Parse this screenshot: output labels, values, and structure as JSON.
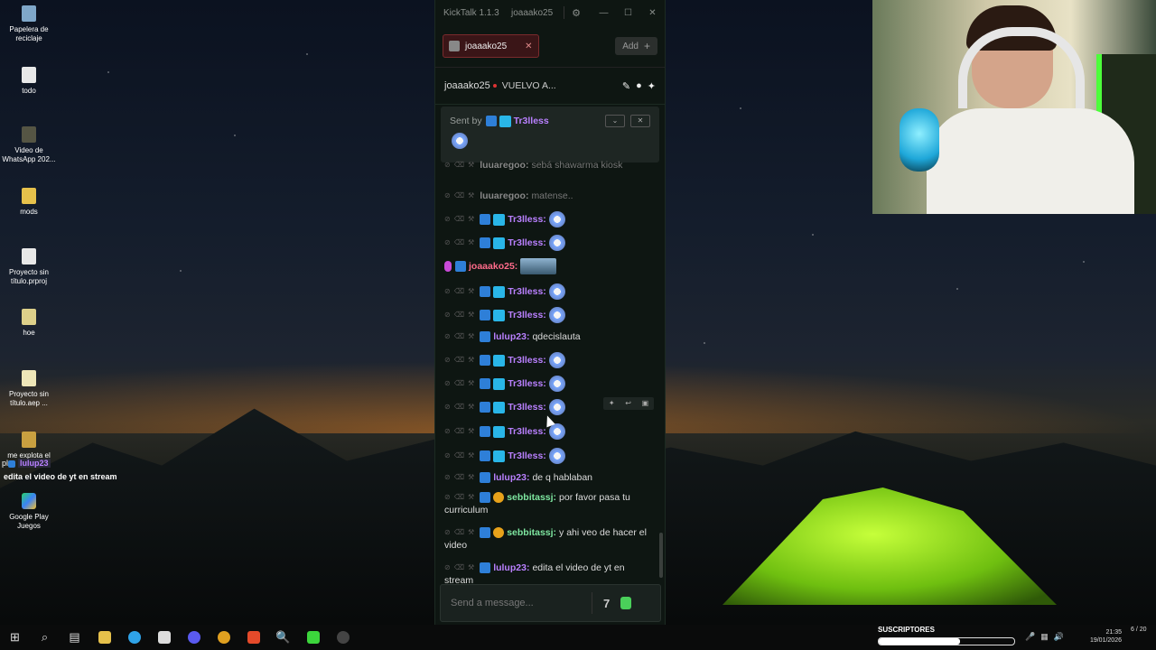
{
  "desktop": {
    "icons": [
      {
        "label": "Papelera de reciclaje",
        "icon": "recycle-bin-icon"
      },
      {
        "label": "todo",
        "icon": "file-icon"
      },
      {
        "label": "Video de WhatsApp 202...",
        "icon": "video-file-icon"
      },
      {
        "label": "mods",
        "icon": "folder-icon"
      },
      {
        "label": "Proyecto sin título.prproj",
        "icon": "file-icon"
      },
      {
        "label": "hoe",
        "icon": "file-icon"
      },
      {
        "label": "Proyecto sin título.aep ...",
        "icon": "file-icon"
      },
      {
        "label": "me explota el",
        "icon": "file-icon"
      },
      {
        "label": "Google Play Juegos",
        "icon": "google-play-games-icon"
      }
    ],
    "overlay_user_prefix": "pl",
    "overlay_user": "lulup23",
    "overlay_msg": "edita el video de yt en stream"
  },
  "app": {
    "title": "KickTalk 1.1.3",
    "channel_label": "joaaako25"
  },
  "tabs": [
    {
      "label": "joaaako25"
    }
  ],
  "add_button": "Add",
  "channel_header": {
    "name": "joaaako25",
    "status": "VUELVO A..."
  },
  "pinned": {
    "prefix": "Sent by",
    "user": "Tr3lless"
  },
  "messages": [
    {
      "user": "luuaregoo",
      "text": "sebá shawarma kiosk",
      "color": "grey",
      "faded": true
    },
    {
      "user": "luuaregoo",
      "text": "matense..",
      "color": "grey",
      "faded": true
    },
    {
      "user": "Tr3lless",
      "text": "",
      "color": "purple",
      "emote": true,
      "cube": true
    },
    {
      "user": "Tr3lless",
      "text": "",
      "color": "purple",
      "emote": true,
      "cube": true
    },
    {
      "user": "joaaako25",
      "text": "",
      "color": "pink",
      "image": true,
      "mic": true
    },
    {
      "user": "Tr3lless",
      "text": "",
      "color": "purple",
      "emote": true,
      "cube": true
    },
    {
      "user": "Tr3lless",
      "text": "",
      "color": "purple",
      "emote": true,
      "cube": true
    },
    {
      "user": "lulup23",
      "text": "qdecislauta",
      "color": "purple"
    },
    {
      "user": "Tr3lless",
      "text": "",
      "color": "purple",
      "emote": true,
      "cube": true
    },
    {
      "user": "Tr3lless",
      "text": "",
      "color": "purple",
      "emote": true,
      "cube": true
    },
    {
      "user": "Tr3lless",
      "text": "",
      "color": "purple",
      "emote": true,
      "cube": true
    },
    {
      "user": "Tr3lless",
      "text": "",
      "color": "purple",
      "emote": true,
      "cube": true
    },
    {
      "user": "Tr3lless",
      "text": "",
      "color": "purple",
      "emote": true,
      "cube": true
    },
    {
      "user": "lulup23",
      "text": "de q hablaban",
      "color": "purple"
    },
    {
      "user": "sebbitassj",
      "text": "por favor pasa tu curriculum",
      "color": "green",
      "gift": true
    },
    {
      "user": "sebbitassj",
      "text": "y ahi veo de hacer el video",
      "color": "green",
      "gift": true
    },
    {
      "user": "lulup23",
      "text": "edita el video de yt en stream",
      "color": "purple"
    }
  ],
  "input": {
    "placeholder": "Send a message..."
  },
  "taskbar": {
    "subs_label": "SUSCRIPTORES",
    "time": "21:35",
    "date": "19/01/2026",
    "subs_progress": 0.6,
    "notif": "6 / 20"
  }
}
